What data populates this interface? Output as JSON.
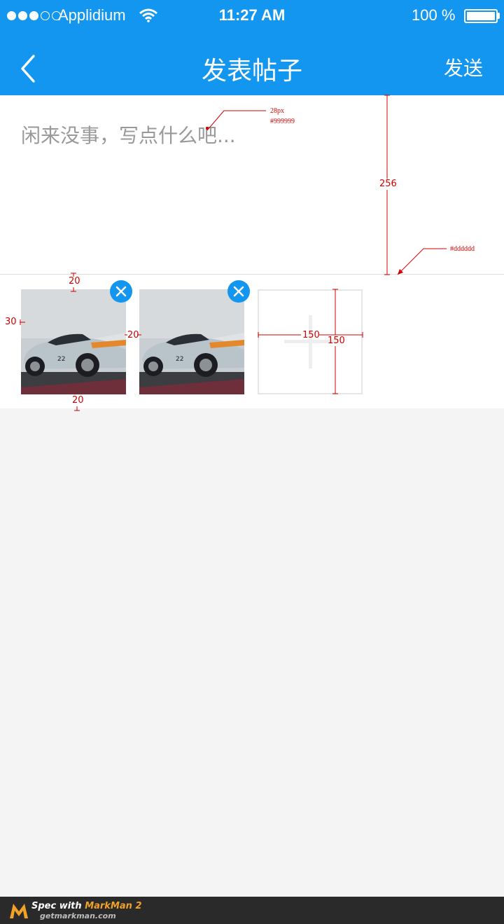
{
  "status_bar": {
    "carrier": "Applidium",
    "time": "11:27 AM",
    "battery": "100 %"
  },
  "nav": {
    "title": "发表帖子",
    "send_label": "发送"
  },
  "composer": {
    "placeholder": "闲来没事，写点什么吧..."
  },
  "colors": {
    "accent": "#1296f0",
    "placeholder": "#999999",
    "divider": "#dddddd",
    "annotation": "#d00000"
  },
  "annotations": {
    "font_size": "28px",
    "font_color": "#999999",
    "area_height": "256",
    "divider_color": "#dddddd",
    "thumb_top_gap": "20",
    "left_margin": "30",
    "thumb_spacing": "20",
    "bottom_gap": "20",
    "tile_width": "150",
    "tile_height": "150"
  },
  "footer": {
    "spec_prefix": "Spec with",
    "brand": "MarkMan 2",
    "site": "getmarkman.com"
  }
}
